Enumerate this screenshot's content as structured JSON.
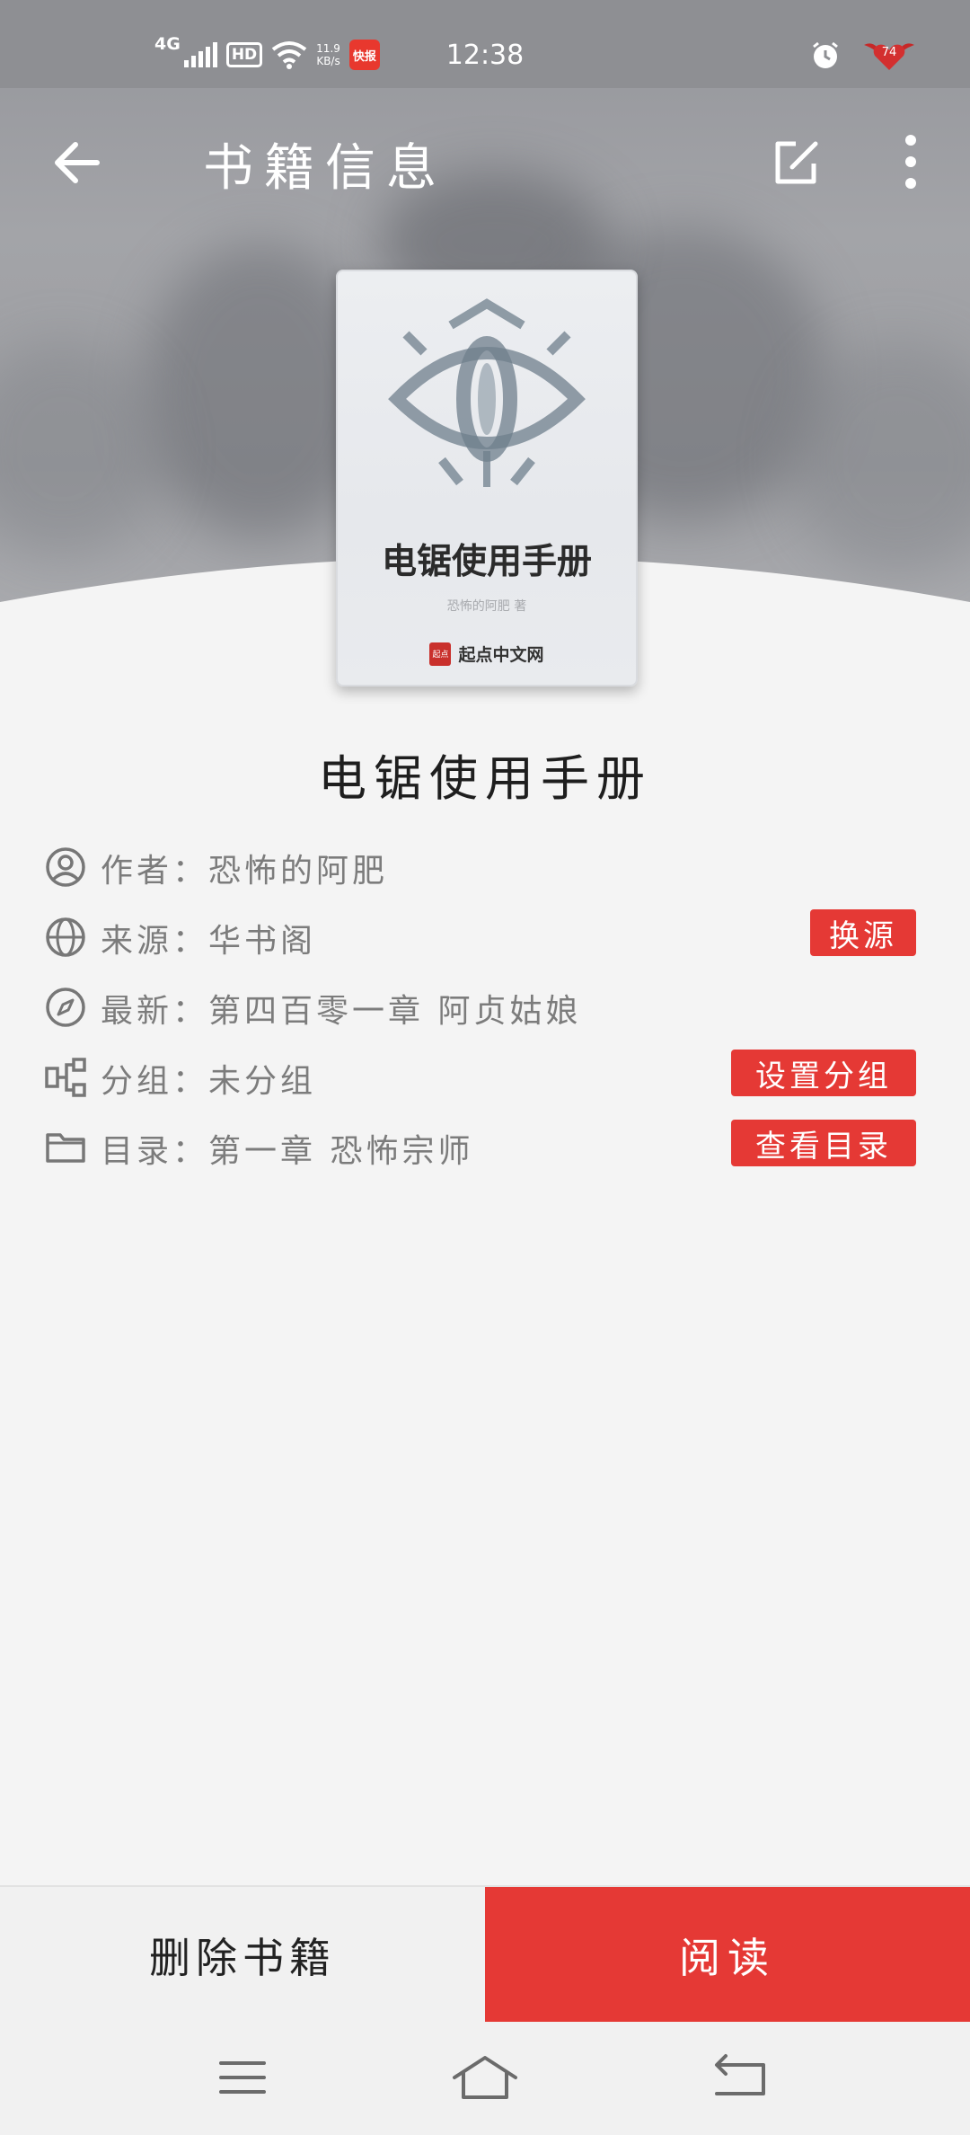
{
  "status_bar": {
    "signal": "4G",
    "hd": "HD",
    "speed_value": "11.9",
    "speed_unit": "KB/s",
    "app_badge": "快报",
    "time": "12:38",
    "battery_level": "74",
    "icons": [
      "signal-icon",
      "wifi-icon",
      "alarm-icon",
      "battery-heart-icon"
    ]
  },
  "toolbar": {
    "title": "书籍信息",
    "back_icon": "arrow-left-icon",
    "edit_icon": "edit-icon",
    "more_icon": "more-vertical-icon"
  },
  "cover": {
    "title": "电锯使用手册",
    "author_line": "恐怖的阿肥 著",
    "publisher": "起点中文网",
    "seal_text": "起点"
  },
  "book": {
    "name": "电锯使用手册",
    "info": {
      "author": "作者：恐怖的阿肥",
      "source": "来源：华书阁",
      "latest": "最新：第四百零一章 阿贞姑娘",
      "group": "分组：未分组",
      "catalog": "目录：第一章 恐怖宗师"
    }
  },
  "actions": {
    "change_source": "换源",
    "set_group": "设置分组",
    "view_catalog": "查看目录"
  },
  "bottom": {
    "delete_label": "删除书籍",
    "read_label": "阅读"
  },
  "colors": {
    "accent": "#e53935",
    "background": "#f4f4f4",
    "header_gray": "#9c9da1",
    "text_secondary": "#7c7c7c"
  },
  "nav": {
    "icons": [
      "menu-icon",
      "home-icon",
      "back-icon"
    ]
  }
}
